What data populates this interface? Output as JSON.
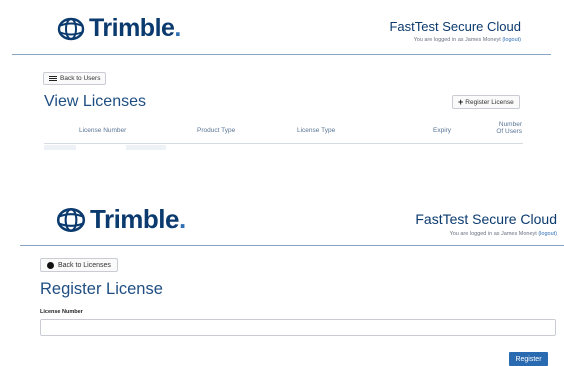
{
  "panel1": {
    "header": {
      "logo_text": "Trimble",
      "logo_dot": ".",
      "app_title": "FastTest Secure Cloud",
      "login_prefix": "You are logged in as James Moneyt",
      "logout": "(logout)"
    },
    "back_button": "Back to Users",
    "heading": "View Licenses",
    "register_button": "Register License",
    "table": {
      "columns": [
        "License Number",
        "Product Type",
        "License Type",
        "Expiry",
        "Number Of Users"
      ]
    }
  },
  "panel2": {
    "header": {
      "logo_text": "Trimble",
      "logo_dot": ".",
      "app_title": "FastTest Secure Cloud",
      "login_prefix": "You are logged in as James Moneyt",
      "logout": "(logout)"
    },
    "back_button": "Back to Licenses",
    "heading": "Register License",
    "license_number_label": "License Number",
    "license_number_value": "",
    "submit_button": "Register"
  },
  "colors": {
    "brand": "#0b3a6e",
    "heading": "#1f4e82",
    "primary_button": "#2a6ab1",
    "link": "#2f6fb5"
  }
}
